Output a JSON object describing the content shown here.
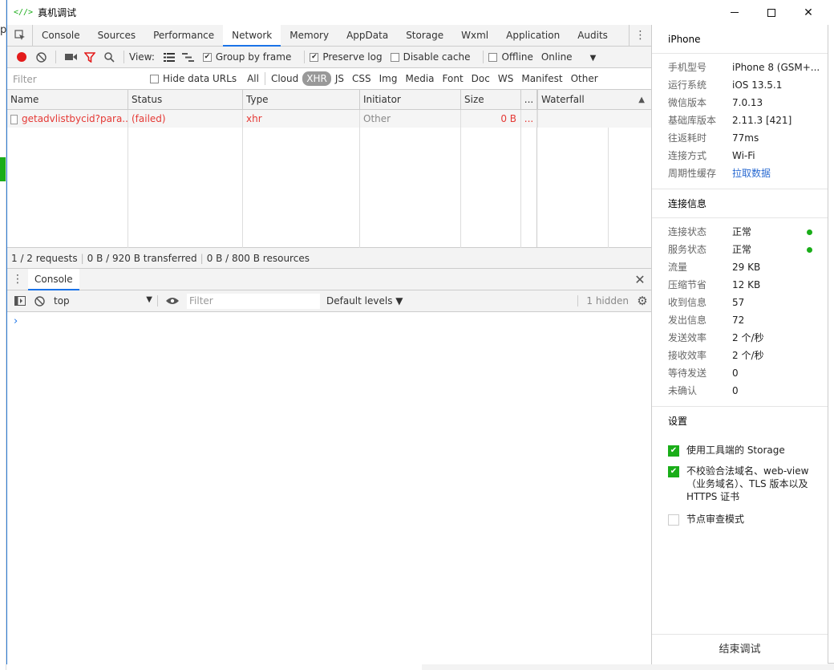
{
  "window": {
    "title": "真机调试",
    "icon": "<//>"
  },
  "devtools_tabs": [
    "Console",
    "Sources",
    "Performance",
    "Network",
    "Memory",
    "AppData",
    "Storage",
    "Wxml",
    "Application",
    "Audits"
  ],
  "active_tab": "Network",
  "toolbar": {
    "view_label": "View:",
    "group_by_frame": "Group by frame",
    "preserve_log": "Preserve log",
    "disable_cache": "Disable cache",
    "offline": "Offline",
    "throttle": "Online"
  },
  "filter": {
    "placeholder": "Filter",
    "hide_data_urls": "Hide data URLs",
    "types": [
      "All",
      "Cloud",
      "XHR",
      "JS",
      "CSS",
      "Img",
      "Media",
      "Font",
      "Doc",
      "WS",
      "Manifest",
      "Other"
    ],
    "selected_type": "XHR"
  },
  "table": {
    "headers": {
      "name": "Name",
      "status": "Status",
      "type": "Type",
      "initiator": "Initiator",
      "size": "Size",
      "more": "...",
      "waterfall": "Waterfall"
    },
    "rows": [
      {
        "name": "getadvlistbycid?para...",
        "status": "(failed)",
        "type": "xhr",
        "initiator": "Other",
        "size": "0 B",
        "more": "..."
      }
    ]
  },
  "summary": {
    "requests": "1 / 2 requests",
    "transferred": "0 B / 920 B transferred",
    "resources": "0 B / 800 B resources"
  },
  "console": {
    "tab": "Console",
    "context": "top",
    "filter_placeholder": "Filter",
    "levels": "Default levels ▼",
    "hidden": "1 hidden",
    "prompt": "›"
  },
  "side": {
    "device_title": "iPhone",
    "device_info": [
      {
        "k": "手机型号",
        "v": "iPhone 8 (GSM+..."
      },
      {
        "k": "运行系统",
        "v": "iOS 13.5.1"
      },
      {
        "k": "微信版本",
        "v": "7.0.13"
      },
      {
        "k": "基础库版本",
        "v": "2.11.3 [421]"
      },
      {
        "k": "往返耗时",
        "v": "77ms"
      },
      {
        "k": "连接方式",
        "v": "Wi-Fi"
      },
      {
        "k": "周期性缓存",
        "v": "拉取数据"
      }
    ],
    "conn_title": "连接信息",
    "conn_info": [
      {
        "k": "连接状态",
        "v": "正常"
      },
      {
        "k": "服务状态",
        "v": "正常"
      },
      {
        "k": "流量",
        "v": "29 KB"
      },
      {
        "k": "压缩节省",
        "v": "12 KB"
      },
      {
        "k": "收到信息",
        "v": "57"
      },
      {
        "k": "发出信息",
        "v": "72"
      },
      {
        "k": "发送效率",
        "v": "2 个/秒"
      },
      {
        "k": "接收效率",
        "v": "2 个/秒"
      },
      {
        "k": "等待发送",
        "v": "0"
      },
      {
        "k": "未确认",
        "v": "0"
      }
    ],
    "settings_title": "设置",
    "settings": [
      {
        "label": "使用工具端的 Storage",
        "checked": true
      },
      {
        "label": "不校验合法域名、web-view（业务域名）、TLS 版本以及 HTTPS 证书",
        "checked": true
      },
      {
        "label": "节点审查模式",
        "checked": false
      }
    ],
    "end_button": "结束调试"
  },
  "colors": {
    "accent": "#1a73e8",
    "success": "#1aad19",
    "error": "#e53935",
    "link": "#2a6ad1"
  }
}
